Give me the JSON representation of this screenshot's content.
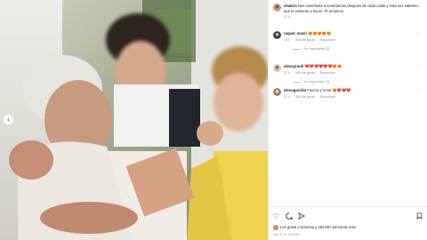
{
  "post": {
    "author": "shakira",
    "caption": "Nos enseñaste a levantarnos después de cada caída y esta vez sabemos que lo volverás a hacer. Te amamos.",
    "age": "22 h",
    "close_icon": "close-icon",
    "prev_icon": "chevron-left-icon"
  },
  "comments": [
    {
      "user": "raquel_masri",
      "text": "😍😍😍😍😍",
      "age": "33 h",
      "likes": "368 Me gusta",
      "reply": "Responder",
      "replies": "Ver respuestas (3)"
    },
    {
      "user": "alenayrardi",
      "text": "❤️❤️❤️❤️❤️❤️😍😍",
      "age": "12 h",
      "likes": "596 Me gusta",
      "reply": "Responder",
      "replies": "Ver respuestas (2)"
    },
    {
      "user": "elenagarrido",
      "text": "Fuerza y Amor 😍❤️❤️❤️",
      "age": "22 h",
      "likes": "456 Me gusta",
      "reply": "Responder",
      "replies": ""
    }
  ],
  "actions": {
    "like_icon": "heart-icon",
    "comment_icon": "comment-icon",
    "share_icon": "share-icon",
    "save_icon": "bookmark-icon"
  },
  "likes_text": "Les gusta a bizarrap y 493.867 personas más",
  "date_text": "HACE 22 HORAS",
  "colors": {
    "link": "#262626",
    "meta": "#8e8e8e",
    "heart_red": "#ed4956"
  }
}
